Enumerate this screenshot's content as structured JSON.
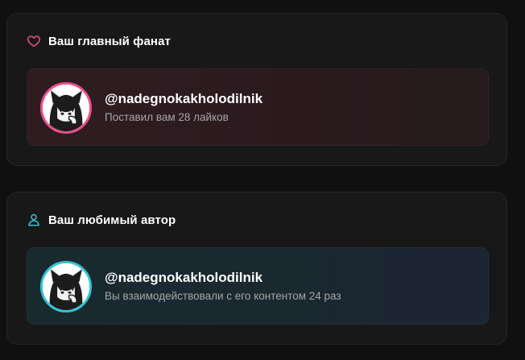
{
  "fan_card": {
    "title": "Ваш главный фанат",
    "icon": "heart-icon",
    "accent": "#ea4f8e",
    "username": "@nadegnokakholodilnik",
    "subtext": "Поставил вам 28 лайков"
  },
  "author_card": {
    "title": "Ваш любимый автор",
    "icon": "user-icon",
    "accent": "#33c3d6",
    "username": "@nadegnokakholodilnik",
    "subtext": "Вы взаимодействовали с его контентом 24 раз"
  }
}
